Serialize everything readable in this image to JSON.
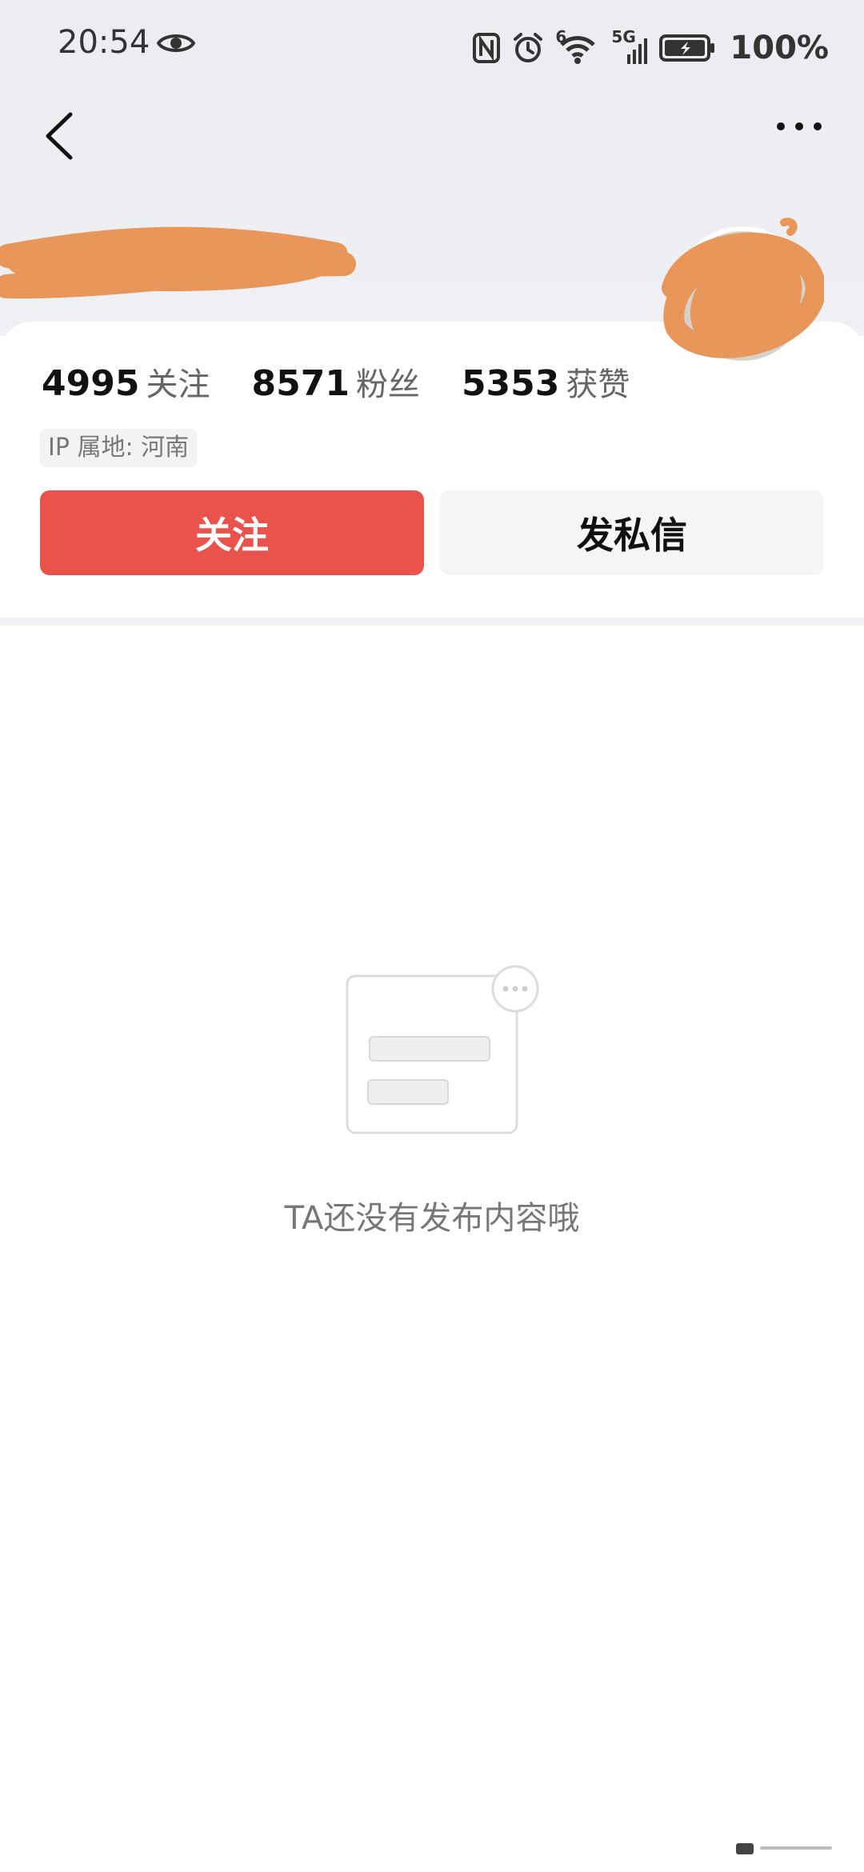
{
  "status_bar": {
    "time": "20:54",
    "battery": "100%",
    "network": "5G",
    "wifi_badge": "6"
  },
  "stats": [
    {
      "value": "4995",
      "label": "关注"
    },
    {
      "value": "8571",
      "label": "粉丝"
    },
    {
      "value": "5353",
      "label": "获赞"
    }
  ],
  "ip_location": "IP 属地: 河南",
  "buttons": {
    "follow": "关注",
    "message": "发私信"
  },
  "empty_state": {
    "text": "TA还没有发布内容哦"
  },
  "colors": {
    "follow_button": "#ea534b",
    "redaction": "#e8965a"
  },
  "icons": [
    "eye-icon",
    "nfc-icon",
    "alarm-icon",
    "wifi-icon",
    "signal-icon",
    "battery-icon",
    "back-icon",
    "more-icon"
  ]
}
